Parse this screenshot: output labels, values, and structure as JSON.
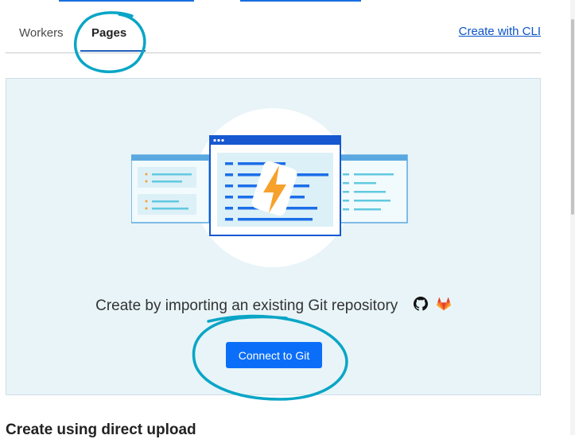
{
  "tabs": [
    {
      "label": "Workers",
      "active": false
    },
    {
      "label": "Pages",
      "active": true
    }
  ],
  "create_cli_link": "Create with CLI",
  "card": {
    "import_text": "Create by importing an existing Git repository",
    "provider_icons": [
      "github-icon",
      "gitlab-icon"
    ],
    "connect_button": "Connect to Git",
    "illustration": "pages-lightning-illustration"
  },
  "direct_upload_title": "Create using direct upload",
  "annotation_color": "#0aa5c6",
  "accent_color": "#0b6ef8"
}
